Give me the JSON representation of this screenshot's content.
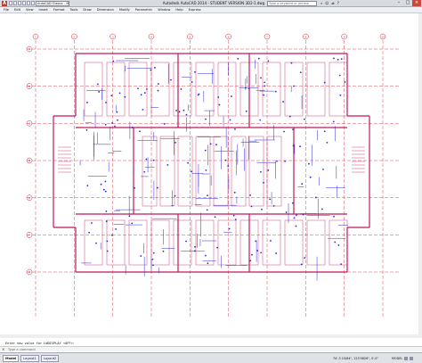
{
  "app": {
    "logo_letter": "A",
    "workspace": "AutoCAD Classic - Migrat...",
    "window_title": "Autodesk AutoCAD 2014 - STUDENT VERSION    3D2-1.dwg",
    "search_placeholder": "Type a keyword or phrase"
  },
  "menubar": {
    "items": [
      "File",
      "Edit",
      "View",
      "Insert",
      "Format",
      "Tools",
      "Draw",
      "Dimension",
      "Modify",
      "Parametric",
      "Window",
      "Help",
      "Express"
    ]
  },
  "drawing": {
    "grid_color": "#d11a2a",
    "line_color": "#2a2ad8",
    "wall_color": "#c2185b",
    "column_labels_top": [
      "1",
      "2",
      "3",
      "4",
      "5",
      "6",
      "7",
      "8",
      "9",
      "10"
    ],
    "row_labels_left": [
      "A",
      "B",
      "C",
      "D",
      "E",
      "F",
      "G"
    ]
  },
  "command": {
    "history": "Enter new value for LWDISPLAY <OFF>:",
    "close_icon": "close-icon",
    "placeholder": "Type a command"
  },
  "status": {
    "tabs": [
      "Model",
      "Layout1",
      "Layout2"
    ],
    "coordinates": "74'-3 15/64\", 123'0826\", 0'-0\"",
    "mode": "MODEL"
  }
}
